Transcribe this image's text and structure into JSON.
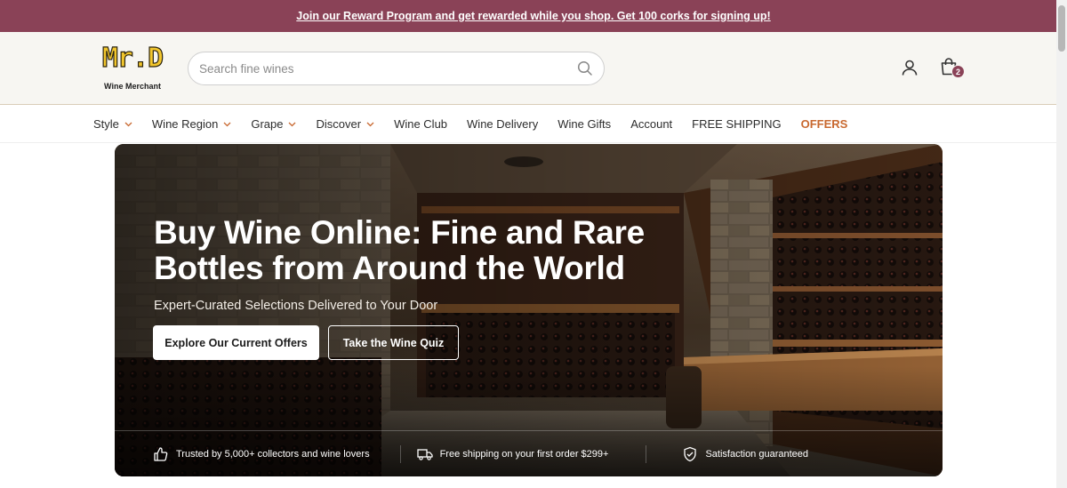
{
  "promo": {
    "text": "Join our Reward Program and get rewarded while you shop. Get 100 corks for signing up!",
    "color": "#8a4257"
  },
  "header": {
    "logo_mark": "Mr.D",
    "logo_sub": "Wine Merchant",
    "search_placeholder": "Search fine wines",
    "cart_count": "2",
    "icons": {
      "search": "search-icon",
      "account": "user-icon",
      "cart": "shopping-bag-icon"
    }
  },
  "nav": {
    "items": [
      {
        "label": "Style",
        "dropdown": true
      },
      {
        "label": "Wine Region",
        "dropdown": true
      },
      {
        "label": "Grape",
        "dropdown": true
      },
      {
        "label": "Discover",
        "dropdown": true
      },
      {
        "label": "Wine Club",
        "dropdown": false
      },
      {
        "label": "Wine Delivery",
        "dropdown": false
      },
      {
        "label": "Wine Gifts",
        "dropdown": false
      },
      {
        "label": "Account",
        "dropdown": false
      },
      {
        "label": "FREE SHIPPING",
        "dropdown": false
      },
      {
        "label": "OFFERS",
        "dropdown": false,
        "accent": "#c8682f"
      }
    ]
  },
  "hero": {
    "title_line1": "Buy Wine Online: Fine and Rare",
    "title_line2": "Bottles from Around the World",
    "subtitle": "Expert-Curated Selections Delivered to Your Door",
    "cta_primary": "Explore Our Current Offers",
    "cta_secondary": "Take the Wine Quiz",
    "features": [
      {
        "icon": "thumbs-up-icon",
        "text": "Trusted by 5,000+ collectors and wine lovers"
      },
      {
        "icon": "truck-icon",
        "text": "Free shipping on your first order $299+"
      },
      {
        "icon": "shield-check-icon",
        "text": "Satisfaction guaranteed"
      }
    ]
  }
}
